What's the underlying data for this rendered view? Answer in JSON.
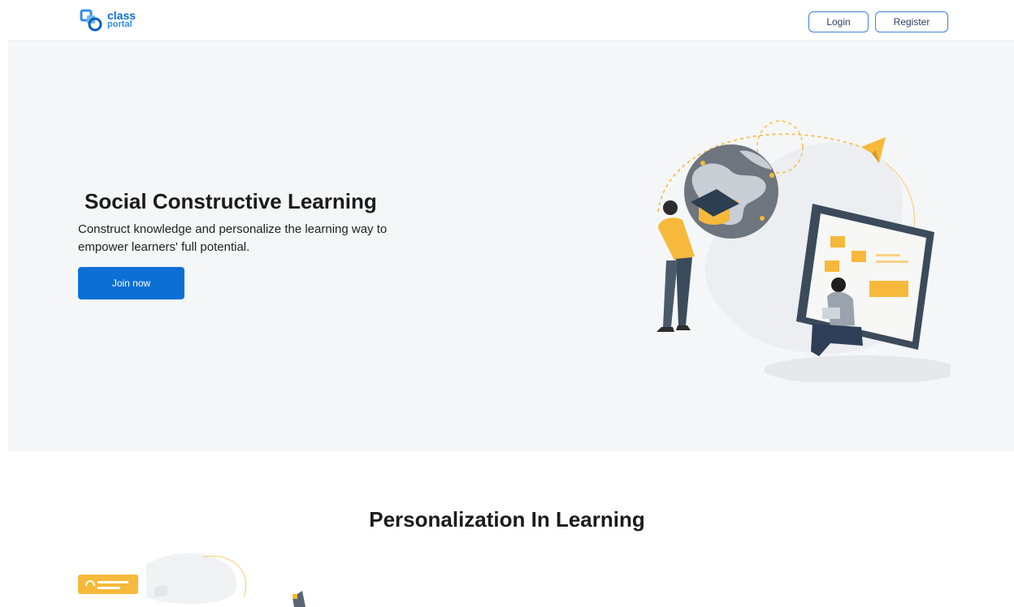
{
  "header": {
    "logo": {
      "line1": "class",
      "line2": "portal"
    },
    "login_label": "Login",
    "register_label": "Register"
  },
  "hero": {
    "title": "Social Constructive Learning",
    "subtitle": "Construct knowledge and personalize the learning way to empower learners' full potential.",
    "cta_label": "Join now",
    "illustration": "globe-learning-illustration"
  },
  "section": {
    "title": "Personalization In Learning",
    "illustration": "personalization-illustration"
  },
  "colors": {
    "brand_blue": "#0b6fd6",
    "hero_bg": "#f5f6f8",
    "accent_yellow": "#f6b93b"
  }
}
